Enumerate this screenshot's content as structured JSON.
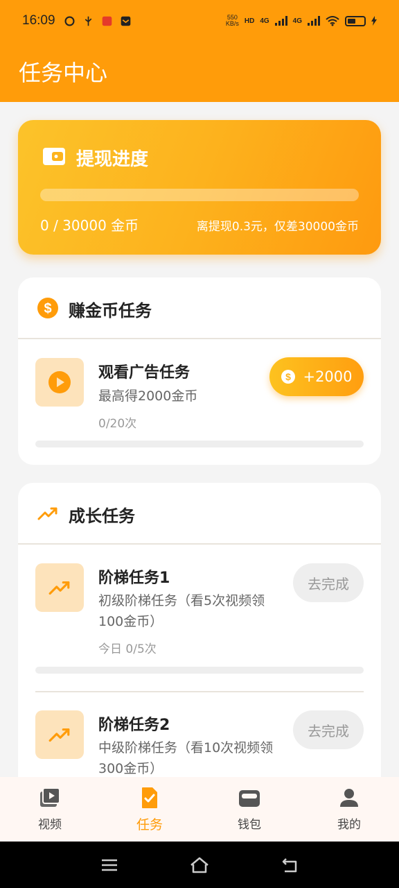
{
  "status_bar": {
    "time": "16:09",
    "net_speed_value": "550",
    "net_speed_unit": "KB/s",
    "hd_label": "HD",
    "signal1": "4G",
    "signal2": "4G"
  },
  "header": {
    "title": "任务中心"
  },
  "withdraw": {
    "title": "提现进度",
    "coins": "0 / 30000 金币",
    "hint": "离提现0.3元，仅差30000金币",
    "progress": 0
  },
  "earn_section": {
    "title": "赚金币任务",
    "tasks": [
      {
        "name": "观看广告任务",
        "desc": "最高得2000金币",
        "count": "0/20次",
        "reward": "+2000",
        "progress": 0
      }
    ]
  },
  "grow_section": {
    "title": "成长任务",
    "tasks": [
      {
        "name": "阶梯任务1",
        "desc": "初级阶梯任务（看5次视频领100金币）",
        "count": "今日 0/5次",
        "button": "去完成",
        "progress": 0
      },
      {
        "name": "阶梯任务2",
        "desc": "中级阶梯任务（看10次视频领300金币）",
        "button": "去完成"
      }
    ]
  },
  "bottom_nav": {
    "items": [
      {
        "label": "视频",
        "icon": "video-icon"
      },
      {
        "label": "任务",
        "icon": "task-icon",
        "active": true
      },
      {
        "label": "钱包",
        "icon": "wallet-icon"
      },
      {
        "label": "我的",
        "icon": "user-icon"
      }
    ]
  },
  "colors": {
    "accent": "#ff9c0a",
    "card_bg": "#ffffff",
    "icon_bg": "#fde3bb"
  }
}
